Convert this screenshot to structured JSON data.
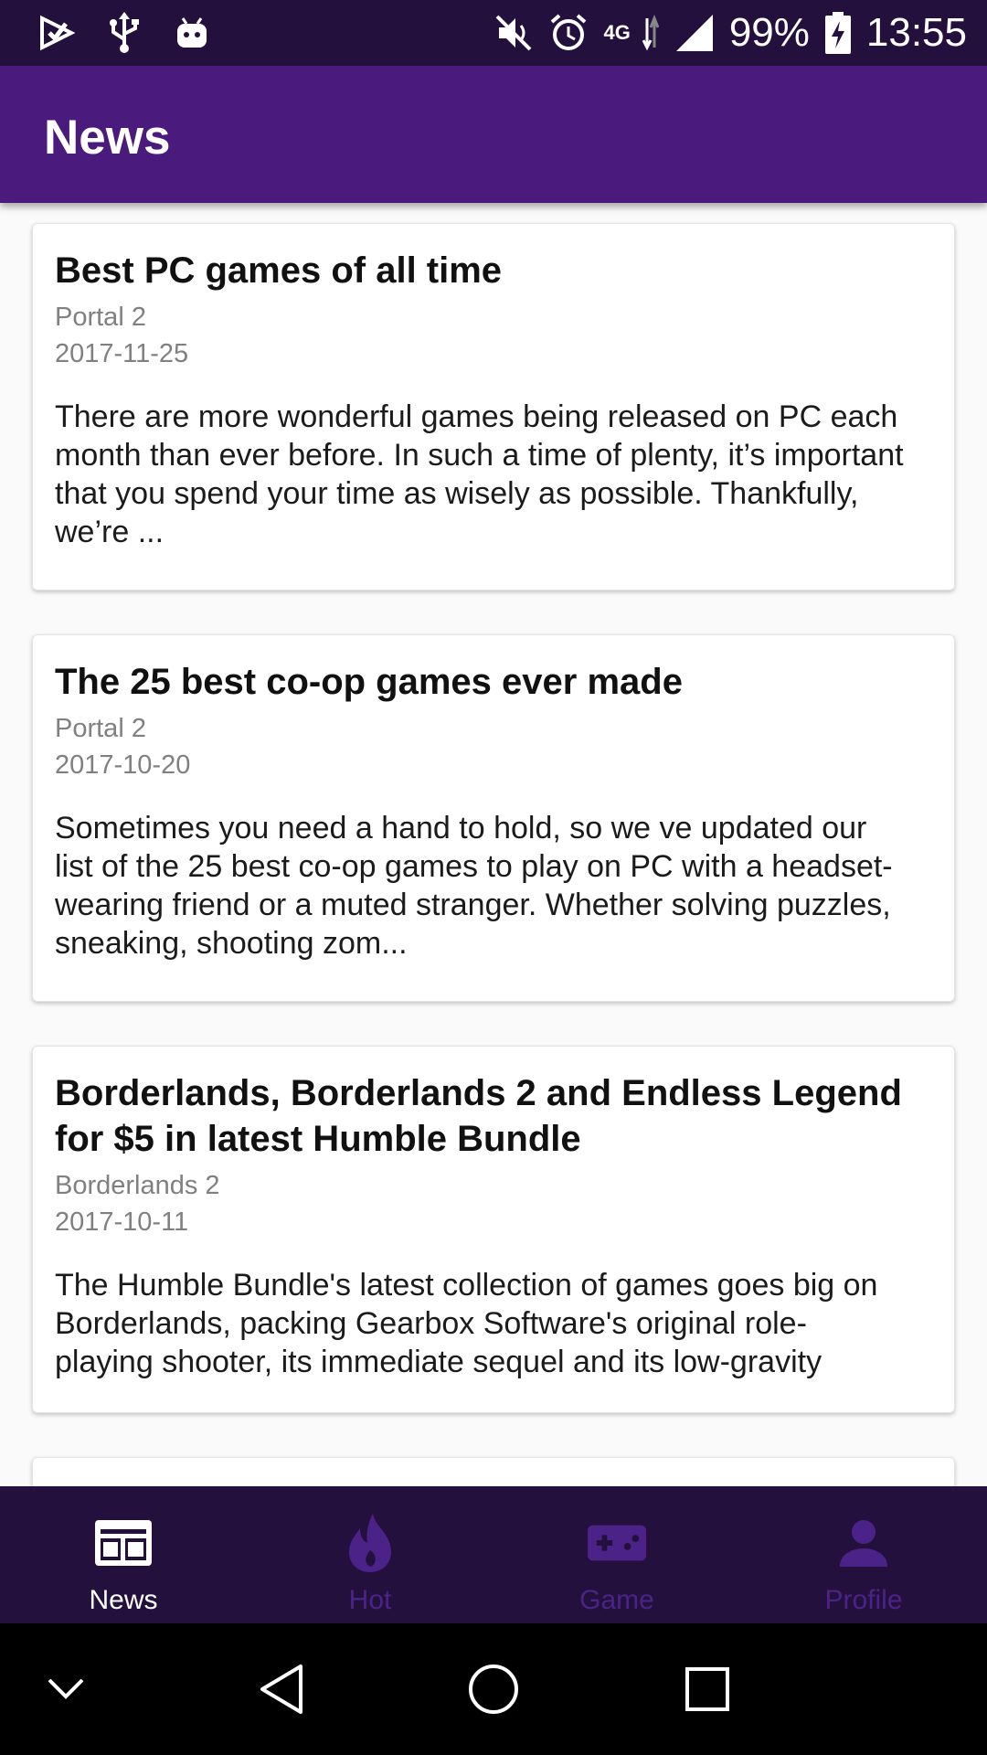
{
  "status_bar": {
    "battery": "99%",
    "time": "13:55",
    "network": "4G",
    "icons": [
      "play-store-icon",
      "usb-icon",
      "android-icon",
      "mute-icon",
      "alarm-icon",
      "data-arrows-icon",
      "signal-icon",
      "battery-charging-icon"
    ]
  },
  "app_bar": {
    "title": "News"
  },
  "news": [
    {
      "title": "Best PC games of all time",
      "game": "Portal 2",
      "date": "2017-11-25",
      "body": "There are more wonderful games being released on PC each month than ever before. In such a time of plenty, it’s important that you spend your time as wisely as possible. Thankfully, we’re ..."
    },
    {
      "title": "The 25 best co-op games ever made",
      "game": "Portal 2",
      "date": "2017-10-20",
      "body": "Sometimes you need a hand to hold, so we ve updated our list of the 25 best co-op games to play on PC with a headset-wearing friend or a muted stranger. Whether solving puzzles, sneaking, shooting zom..."
    },
    {
      "title": "Borderlands, Borderlands 2 and Endless Legend for $5 in latest Humble Bundle",
      "game": "Borderlands 2",
      "date": "2017-10-11",
      "body": "The Humble Bundle's latest collection of games goes big on Borderlands, packing Gearbox Software's original role-playing shooter, its immediate sequel and its low-gravity follow-up Borderlands..."
    }
  ],
  "bottom_nav": {
    "items": [
      {
        "label": "News",
        "icon": "news-icon",
        "active": true
      },
      {
        "label": "Hot",
        "icon": "flame-icon",
        "active": false
      },
      {
        "label": "Game",
        "icon": "gamepad-icon",
        "active": false
      },
      {
        "label": "Profile",
        "icon": "person-icon",
        "active": false
      }
    ],
    "active_color": "#ffffff",
    "inactive_color": "#4b2388"
  },
  "system_nav": {
    "icons": [
      "chevron-down-icon",
      "back-icon",
      "home-icon",
      "recents-icon"
    ]
  },
  "colors": {
    "status_bar": "#24103d",
    "app_bar": "#4a1a7c",
    "bottom_nav": "#24103d",
    "secondary_text": "#808080"
  }
}
